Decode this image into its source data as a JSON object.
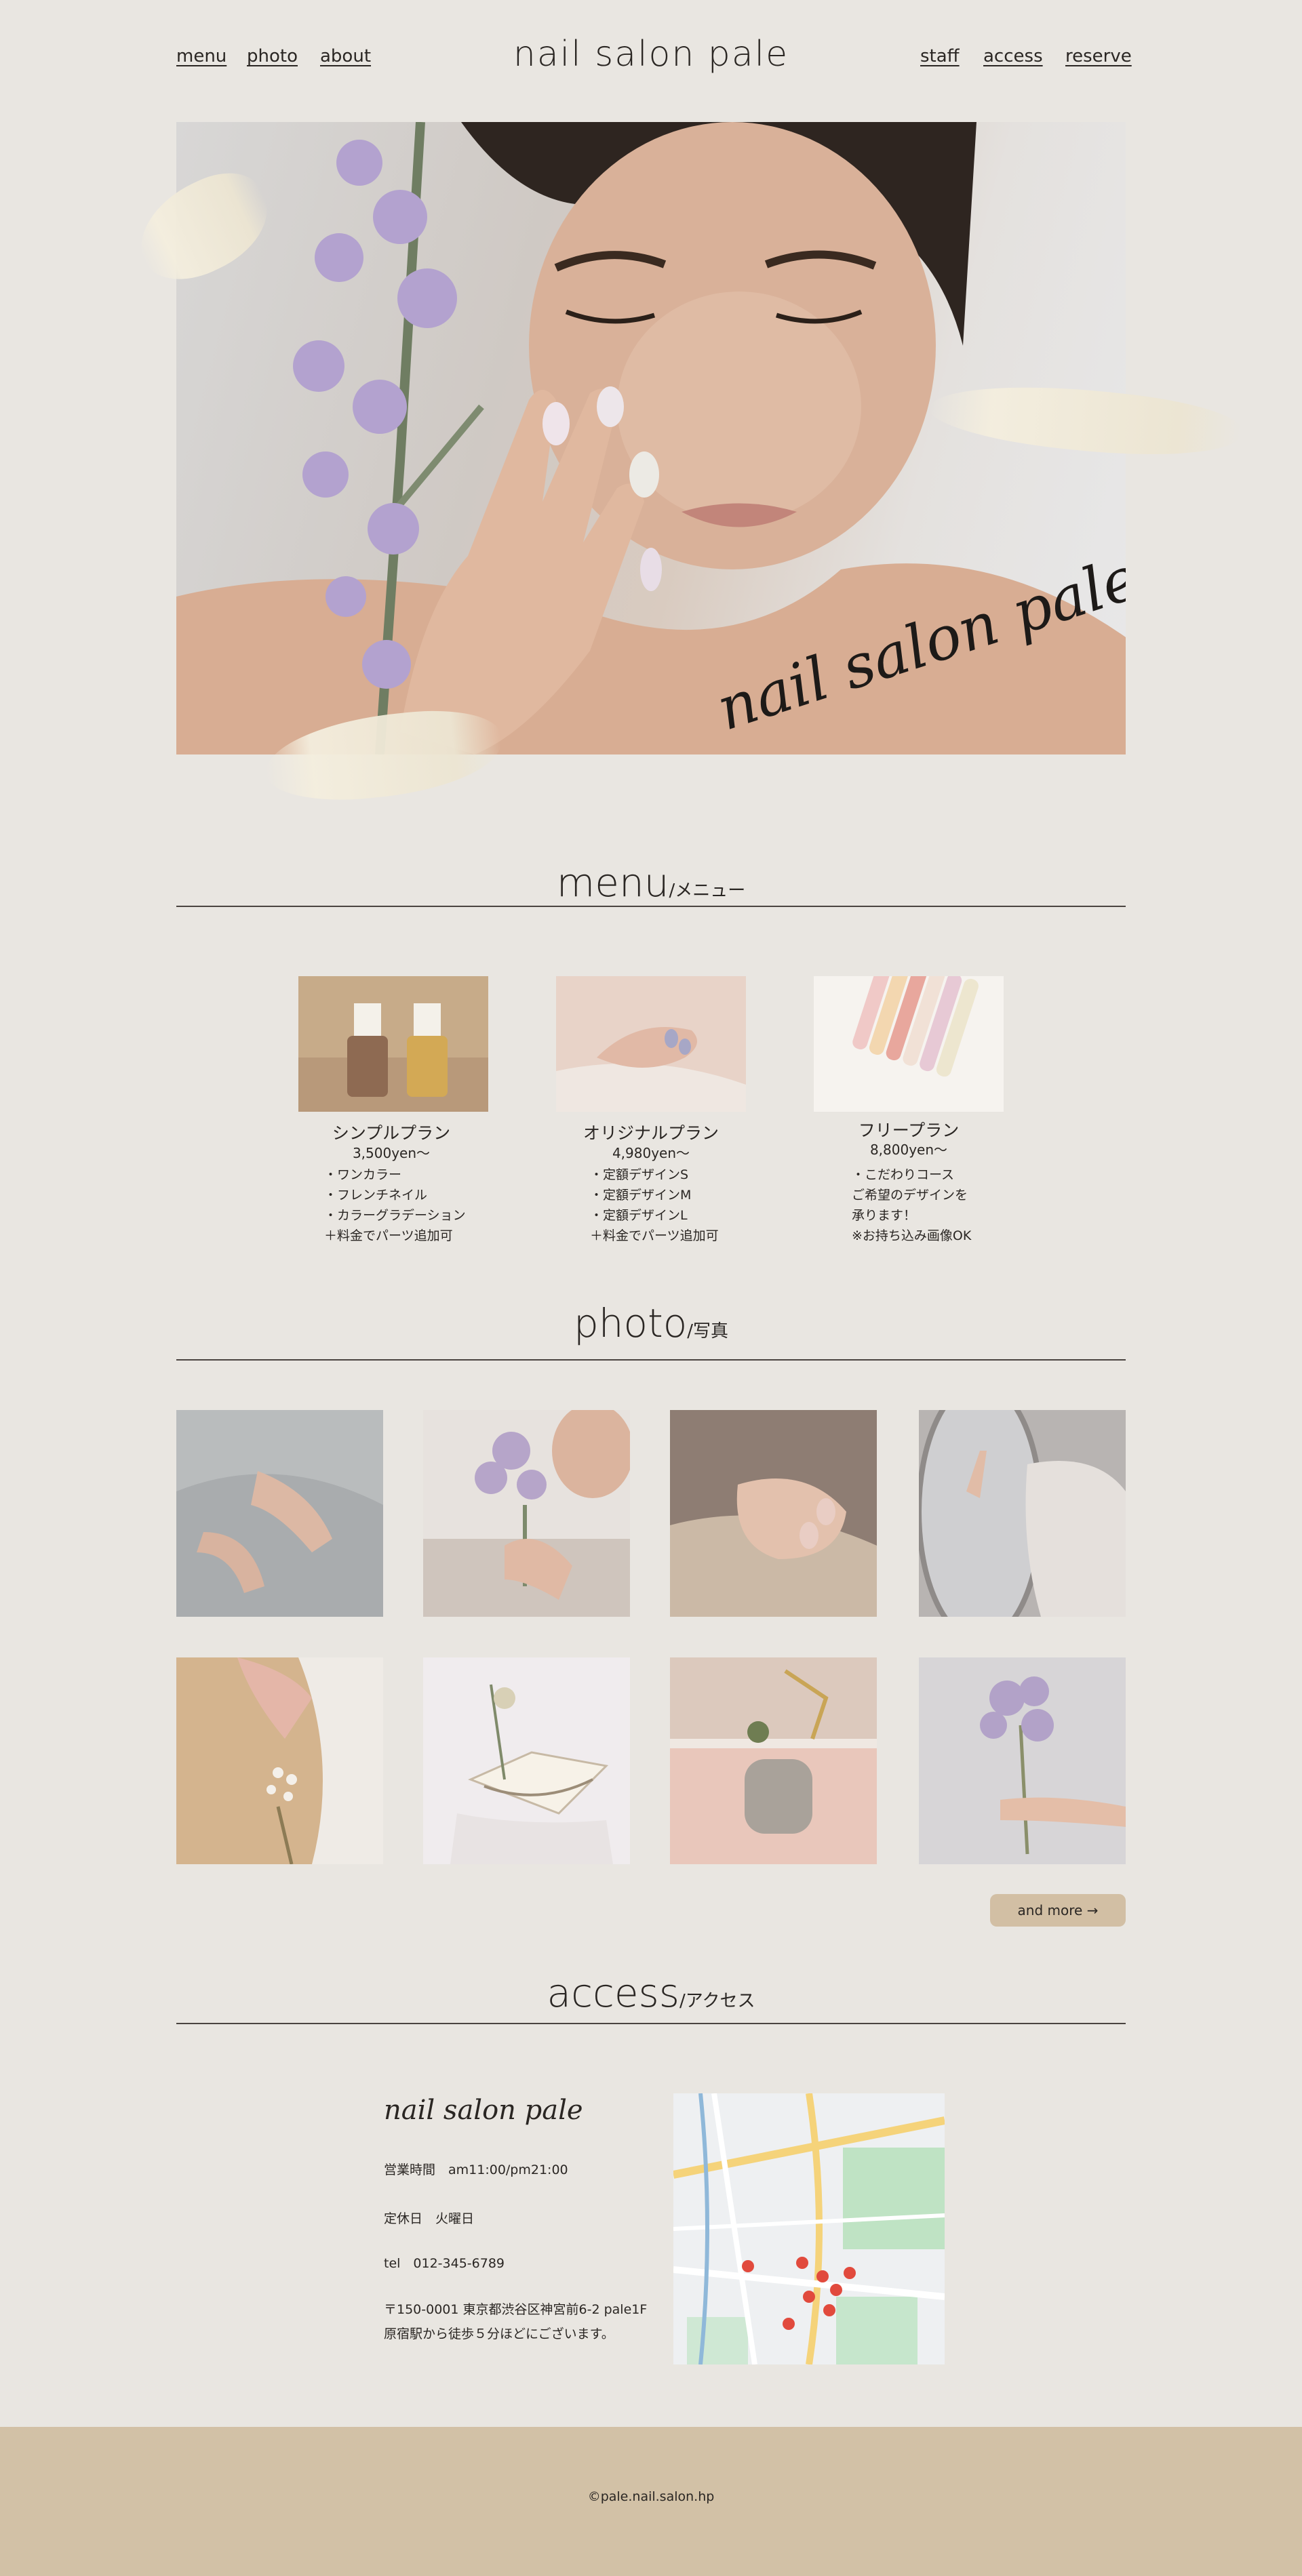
{
  "header": {
    "nav_left": [
      "menu",
      "photo",
      "about"
    ],
    "title": "nail salon pale",
    "nav_right": [
      "staff",
      "access",
      "reserve"
    ]
  },
  "hero": {
    "script_text": "nail  salon  pale"
  },
  "menu_section": {
    "title": "menu",
    "subtitle": "/メニュー",
    "cards": [
      {
        "name": "シンプルプラン",
        "price": "3,500yen～",
        "items": [
          "・ワンカラー",
          "・フレンチネイル",
          "・カラーグラデーション",
          "＋料金でパーツ追加可"
        ]
      },
      {
        "name": "オリジナルプラン",
        "price": "4,980yen～",
        "items": [
          "・定額デザインS",
          "・定額デザインM",
          "・定額デザインL",
          "＋料金でパーツ追加可"
        ]
      },
      {
        "name": "フリープラン",
        "price": "8,800yen～",
        "items": [
          "・こだわりコース",
          "ご希望のデザインを",
          "承ります！",
          "※お持ち込み画像OK"
        ]
      }
    ]
  },
  "photo_section": {
    "title": "photo",
    "subtitle": "/写真",
    "more_label": "and more →"
  },
  "access_section": {
    "title": "access",
    "subtitle": "/アクセス",
    "brand_script": "nail  salon  pale",
    "hours": "営業時間　am11:00/pm21:00",
    "closed": "定休日　火曜日",
    "tel": "tel　012-345-6789",
    "address": "〒150-0001 東京都渋谷区神宮前6-2 pale1F",
    "directions": "原宿駅から徒歩５分ほどにございます。"
  },
  "footer": {
    "copyright": "©pale.nail.salon.hp"
  },
  "colors": {
    "background": "#e9e6e1",
    "footer": "#d2c1a6",
    "button": "#d2bfa4",
    "text": "#2a2623"
  }
}
